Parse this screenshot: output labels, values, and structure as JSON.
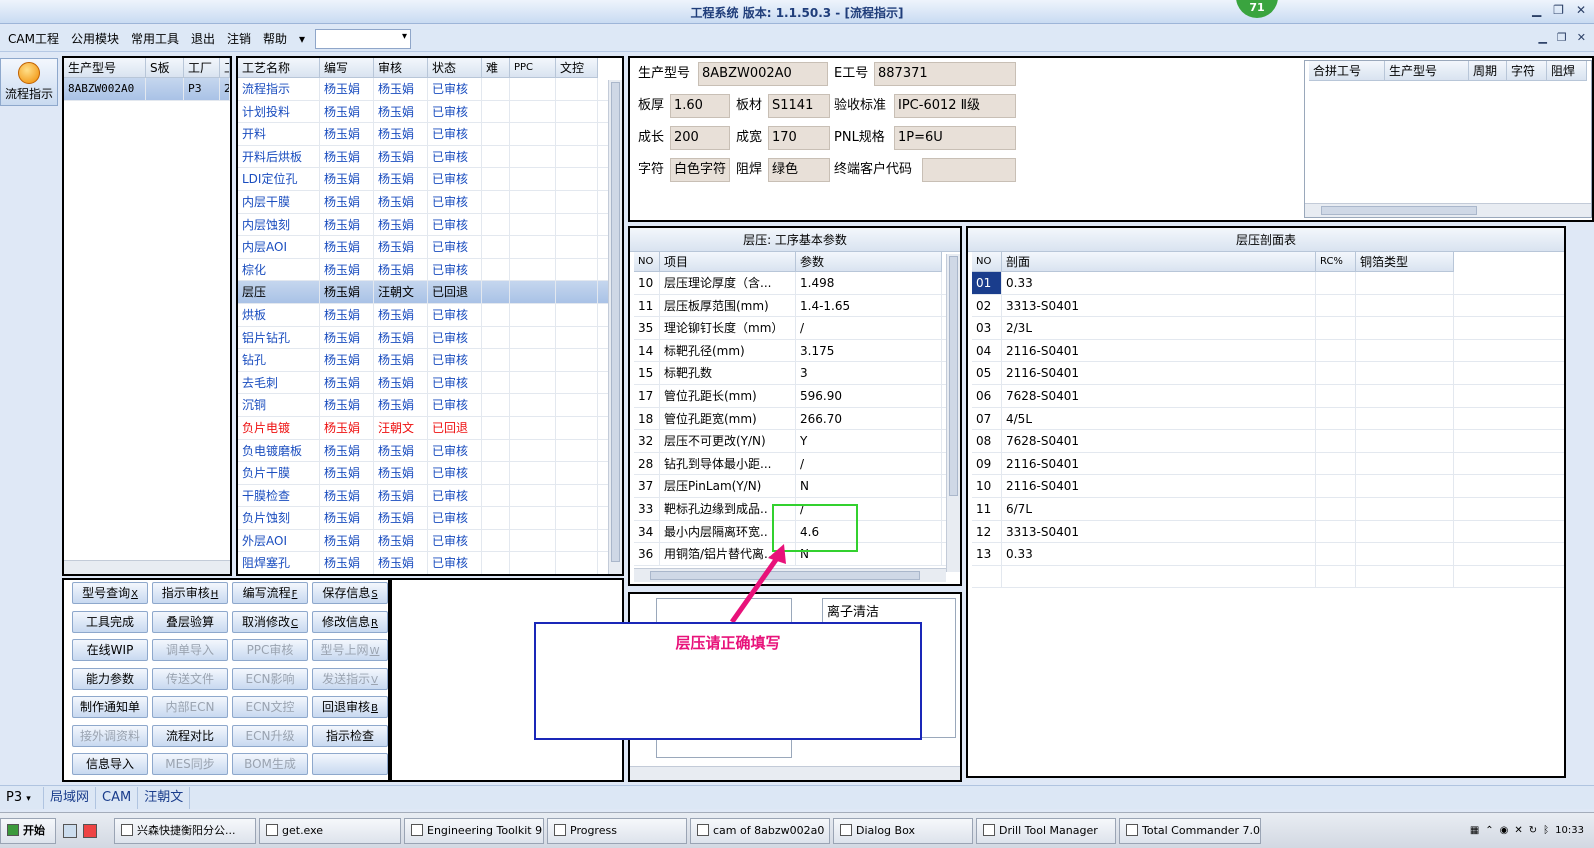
{
  "window": {
    "title": "工程系统  版本: 1.1.50.3 - [流程指示]",
    "badge": "71"
  },
  "menu": {
    "items": [
      "CAM工程",
      "公用模块",
      "常用工具",
      "退出",
      "注销",
      "帮助"
    ],
    "more": "▾"
  },
  "side": {
    "tool_label": "流程指示"
  },
  "models": {
    "headers": [
      "生产型号",
      "S板",
      "工厂",
      "工"
    ],
    "rows": [
      [
        "8ABZW002A0",
        "",
        "P3",
        "2"
      ]
    ]
  },
  "process": {
    "headers": [
      "工艺名称",
      "编写",
      "审核",
      "状态",
      "难",
      "PPC",
      "文控"
    ],
    "rows": [
      {
        "name": "流程指示",
        "writer": "杨玉娟",
        "reviewer": "杨玉娟",
        "status": "已审核",
        "style": "blue"
      },
      {
        "name": "计划投料",
        "writer": "杨玉娟",
        "reviewer": "杨玉娟",
        "status": "已审核",
        "style": "blue"
      },
      {
        "name": "开料",
        "writer": "杨玉娟",
        "reviewer": "杨玉娟",
        "status": "已审核",
        "style": "blue"
      },
      {
        "name": "开料后烘板",
        "writer": "杨玉娟",
        "reviewer": "杨玉娟",
        "status": "已审核",
        "style": "blue"
      },
      {
        "name": "LDI定位孔",
        "writer": "杨玉娟",
        "reviewer": "杨玉娟",
        "status": "已审核",
        "style": "blue"
      },
      {
        "name": "内层干膜",
        "writer": "杨玉娟",
        "reviewer": "杨玉娟",
        "status": "已审核",
        "style": "blue"
      },
      {
        "name": "内层蚀刻",
        "writer": "杨玉娟",
        "reviewer": "杨玉娟",
        "status": "已审核",
        "style": "blue"
      },
      {
        "name": "内层AOI",
        "writer": "杨玉娟",
        "reviewer": "杨玉娟",
        "status": "已审核",
        "style": "blue"
      },
      {
        "name": "棕化",
        "writer": "杨玉娟",
        "reviewer": "杨玉娟",
        "status": "已审核",
        "style": "blue"
      },
      {
        "name": "层压",
        "writer": "杨玉娟",
        "reviewer": "汪朝文",
        "status": "已回退",
        "style": "selected"
      },
      {
        "name": "烘板",
        "writer": "杨玉娟",
        "reviewer": "杨玉娟",
        "status": "已审核",
        "style": "blue"
      },
      {
        "name": "铝片钻孔",
        "writer": "杨玉娟",
        "reviewer": "杨玉娟",
        "status": "已审核",
        "style": "blue"
      },
      {
        "name": "钻孔",
        "writer": "杨玉娟",
        "reviewer": "杨玉娟",
        "status": "已审核",
        "style": "blue"
      },
      {
        "name": "去毛刺",
        "writer": "杨玉娟",
        "reviewer": "杨玉娟",
        "status": "已审核",
        "style": "blue"
      },
      {
        "name": "沉铜",
        "writer": "杨玉娟",
        "reviewer": "杨玉娟",
        "status": "已审核",
        "style": "blue"
      },
      {
        "name": "负片电镀",
        "writer": "杨玉娟",
        "reviewer": "汪朝文",
        "status": "已回退",
        "style": "red"
      },
      {
        "name": "负电镀磨板",
        "writer": "杨玉娟",
        "reviewer": "杨玉娟",
        "status": "已审核",
        "style": "blue"
      },
      {
        "name": "负片干膜",
        "writer": "杨玉娟",
        "reviewer": "杨玉娟",
        "status": "已审核",
        "style": "blue"
      },
      {
        "name": "干膜检查",
        "writer": "杨玉娟",
        "reviewer": "杨玉娟",
        "status": "已审核",
        "style": "blue"
      },
      {
        "name": "负片蚀刻",
        "writer": "杨玉娟",
        "reviewer": "杨玉娟",
        "status": "已审核",
        "style": "blue"
      },
      {
        "name": "外层AOI",
        "writer": "杨玉娟",
        "reviewer": "杨玉娟",
        "status": "已审核",
        "style": "blue"
      },
      {
        "name": "阻焊塞孔",
        "writer": "杨玉娟",
        "reviewer": "杨玉娟",
        "status": "已审核",
        "style": "blue"
      }
    ]
  },
  "buttons": [
    {
      "label": "型号查询",
      "key": "X",
      "enabled": true
    },
    {
      "label": "指示审核",
      "key": "H",
      "enabled": true
    },
    {
      "label": "编写流程",
      "key": "F",
      "enabled": true
    },
    {
      "label": "保存信息",
      "key": "S",
      "enabled": true
    },
    {
      "label": "工具完成",
      "key": "",
      "enabled": true
    },
    {
      "label": "叠层验算",
      "key": "",
      "enabled": true
    },
    {
      "label": "取消修改",
      "key": "C",
      "enabled": true
    },
    {
      "label": "修改信息",
      "key": "R",
      "enabled": true
    },
    {
      "label": "在线WIP",
      "key": "",
      "enabled": true
    },
    {
      "label": "调单导入",
      "key": "",
      "enabled": false
    },
    {
      "label": "PPC审核",
      "key": "",
      "enabled": false
    },
    {
      "label": "型号上网",
      "key": "W",
      "enabled": false
    },
    {
      "label": "能力参数",
      "key": "",
      "enabled": true
    },
    {
      "label": "传送文件",
      "key": "",
      "enabled": false
    },
    {
      "label": "ECN影响",
      "key": "",
      "enabled": false
    },
    {
      "label": "发送指示",
      "key": "V",
      "enabled": false
    },
    {
      "label": "制作通知单",
      "key": "",
      "enabled": true
    },
    {
      "label": "内部ECN",
      "key": "",
      "enabled": false
    },
    {
      "label": "ECN文控",
      "key": "",
      "enabled": false
    },
    {
      "label": "回退审核",
      "key": "B",
      "enabled": true
    },
    {
      "label": "接外调资料",
      "key": "",
      "enabled": false
    },
    {
      "label": "流程对比",
      "key": "",
      "enabled": true
    },
    {
      "label": "ECN升级",
      "key": "",
      "enabled": false
    },
    {
      "label": "指示检查",
      "key": "",
      "enabled": true
    },
    {
      "label": "信息导入",
      "key": "",
      "enabled": true
    },
    {
      "label": "MES同步",
      "key": "",
      "enabled": false
    },
    {
      "label": "BOM生成",
      "key": "",
      "enabled": false
    },
    {
      "label": "",
      "key": "",
      "enabled": true
    }
  ],
  "info": {
    "model_label": "生产型号",
    "model": "8ABZW002A0",
    "e_label": "E工号",
    "e_no": "887371",
    "thick_label": "板厚",
    "thick": "1.60",
    "mat_label": "板材",
    "mat": "S1141",
    "std_label": "验收标准",
    "std": "IPC-6012 Ⅱ级",
    "len_label": "成长",
    "len": "200",
    "wid_label": "成宽",
    "wid": "170",
    "pnl_label": "PNL规格",
    "pnl": "1P=6U",
    "char_label": "字符",
    "char": "白色字符",
    "mask_label": "阻焊",
    "mask": "绿色",
    "cust_label": "终端客户代码",
    "cust": ""
  },
  "merge": {
    "headers": [
      "合拼工号",
      "生产型号",
      "周期",
      "字符",
      "阻焊"
    ]
  },
  "params": {
    "title": "层压: 工序基本参数",
    "headers": [
      "NO",
      "项目",
      "参数"
    ],
    "rows": [
      [
        "10",
        "层压理论厚度（含...",
        "1.498"
      ],
      [
        "11",
        "层压板厚范围(mm)",
        "1.4-1.65"
      ],
      [
        "35",
        "理论铆钉长度（mm）",
        "/"
      ],
      [
        "14",
        "标靶孔径(mm)",
        "3.175"
      ],
      [
        "15",
        "标靶孔数",
        "3"
      ],
      [
        "17",
        "管位孔距长(mm)",
        "596.90"
      ],
      [
        "18",
        "管位孔距宽(mm)",
        "266.70"
      ],
      [
        "32",
        "层压不可更改(Y/N)",
        "Y"
      ],
      [
        "28",
        "钻孔到导体最小距...",
        "/"
      ],
      [
        "37",
        "层压PinLam(Y/N)",
        "N"
      ],
      [
        "33",
        "靶标孔边缘到成品..",
        "/"
      ],
      [
        "34",
        "最小内层隔离环宽..",
        "4.6"
      ],
      [
        "36",
        "用铜箔/铝片替代离...",
        "N"
      ]
    ]
  },
  "stack": {
    "title": "层压剖面表",
    "headers": [
      "NO",
      "剖面",
      "RC%",
      "铜箔类型"
    ],
    "rows": [
      [
        "01",
        "0.33"
      ],
      [
        "02",
        "3313-S0401"
      ],
      [
        "03",
        "2/3L"
      ],
      [
        "04",
        "2116-S0401"
      ],
      [
        "05",
        "2116-S0401"
      ],
      [
        "06",
        "7628-S0401"
      ],
      [
        "07",
        "4/5L"
      ],
      [
        "08",
        "7628-S0401"
      ],
      [
        "09",
        "2116-S0401"
      ],
      [
        "10",
        "2116-S0401"
      ],
      [
        "11",
        "6/7L"
      ],
      [
        "12",
        "3313-S0401"
      ],
      [
        "13",
        "0.33"
      ]
    ]
  },
  "notes": {
    "right_text": "离子清洁"
  },
  "annotation": {
    "text": "层压请正确填写",
    "color": "#e8127a"
  },
  "status": {
    "factory": "P3",
    "tabs": [
      "局域网",
      "CAM",
      "汪朝文"
    ]
  },
  "taskbar": {
    "start": "开始",
    "items": [
      "兴森快捷衡阳分公...",
      "get.exe",
      "Engineering Toolkit 9....",
      "Progress",
      "cam of 8abzw002a0",
      "Dialog Box",
      "Drill Tool Manager",
      "Total Commander 7.0 ..."
    ],
    "time": "10:33"
  }
}
